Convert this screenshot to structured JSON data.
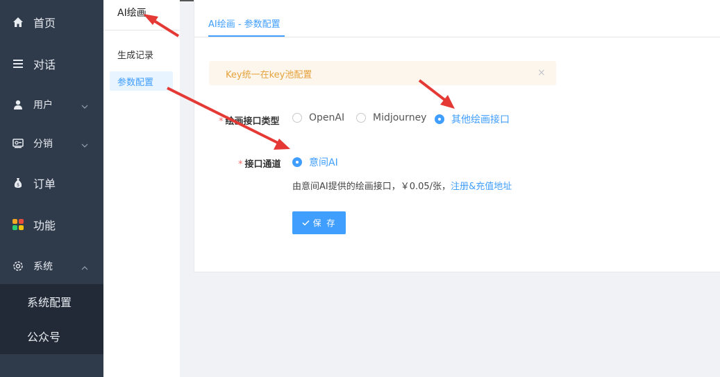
{
  "sidebar": {
    "items": [
      {
        "label": "首页",
        "icon": "home-icon"
      },
      {
        "label": "对话",
        "icon": "list-icon"
      },
      {
        "label": "用户",
        "icon": "user-icon"
      },
      {
        "label": "分销",
        "icon": "distribution-icon"
      },
      {
        "label": "订单",
        "icon": "money-bag-icon"
      },
      {
        "label": "功能",
        "icon": "grid-icon"
      },
      {
        "label": "系统",
        "icon": "gear-icon"
      }
    ],
    "submenu": [
      {
        "label": "系统配置"
      },
      {
        "label": "公众号"
      }
    ]
  },
  "subnav": {
    "title": "AI绘画",
    "items": [
      {
        "label": "生成记录"
      },
      {
        "label": "参数配置"
      }
    ]
  },
  "main": {
    "tab": "AI绘画 - 参数配置",
    "alert": {
      "text": "Key统一在key池配置",
      "close": "×"
    },
    "api_type": {
      "label": "绘画接口类型",
      "required": "*",
      "options": [
        "OpenAI",
        "Midjourney",
        "其他绘画接口"
      ],
      "selected": "其他绘画接口"
    },
    "channel": {
      "label": "接口通道",
      "required": "*",
      "options": [
        "意间AI"
      ],
      "selected": "意间AI"
    },
    "description": {
      "text": "由意间AI提供的绘画接口，￥0.05/张，",
      "link": "注册&充值地址"
    },
    "save_label": "保 存"
  },
  "colors": {
    "accent": "#409eff",
    "sidebar_bg": "#2f3a4a",
    "alert_bg": "#fdf6ec",
    "alert_text": "#e6a23c",
    "annotation": "#e53935"
  }
}
